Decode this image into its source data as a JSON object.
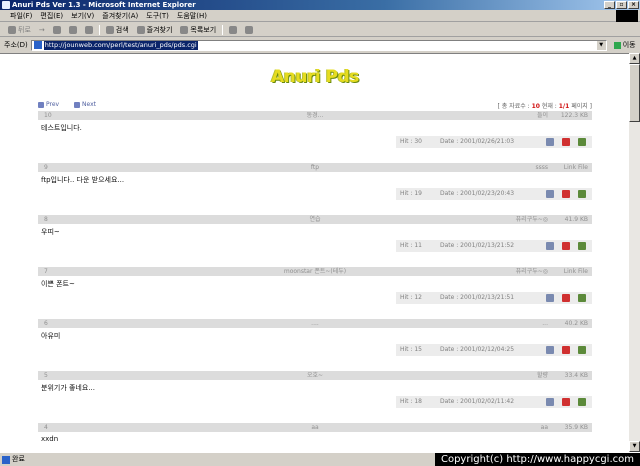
{
  "window": {
    "title": "Anuri Pds Ver 1.3 - Microsoft Internet Explorer",
    "btn_min": "_",
    "btn_max": "▫",
    "btn_close": "×"
  },
  "menu": [
    "파일(F)",
    "편집(E)",
    "보기(V)",
    "즐겨찾기(A)",
    "도구(T)",
    "도움말(H)"
  ],
  "toolbar": {
    "back": "뒤로",
    "forward": "→",
    "search": "검색",
    "favorites": "즐겨찾기",
    "history": "목록보기"
  },
  "address": {
    "label": "주소(D)",
    "url": "http://jounweb.com/perl/test/anuri_pds/pds.cgi",
    "go": "이동"
  },
  "logo": "Anuri Pds",
  "nav": {
    "prev": "Prev",
    "next": "Next",
    "info_prefix": "[ 총 자료수 : ",
    "total": "10",
    "info_mid": " 현재 : ",
    "page": "1/1",
    "info_suffix": " 페이지 ]"
  },
  "posts": [
    {
      "num": "10",
      "title": "동경...",
      "author": "들이",
      "size": "122.3 KB",
      "body": "테스트입니다.",
      "hit": "Hit : 30",
      "date": "Date : 2001/02/26/21:03"
    },
    {
      "num": "9",
      "title": "ftp",
      "author": "ssss",
      "size": "Link File",
      "body": "ftp입니다.. 다운 받으세요...",
      "hit": "Hit : 19",
      "date": "Date : 2001/02/23/20:43"
    },
    {
      "num": "8",
      "title": "연습",
      "author": "퓨리구두~◎",
      "size": "41.9 KB",
      "body": "우띠~",
      "hit": "Hit : 11",
      "date": "Date : 2001/02/13/21:52"
    },
    {
      "num": "7",
      "title": "moonstar 폰트~(테두)",
      "author": "퓨리구두~◎",
      "size": "Link File",
      "body": "이쁜 폰트~",
      "hit": "Hit : 12",
      "date": "Date : 2001/02/13/21:51"
    },
    {
      "num": "6",
      "title": "....",
      "author": "...",
      "size": "40.2 KB",
      "body": "아유미",
      "hit": "Hit : 15",
      "date": "Date : 2001/02/12/04:25"
    },
    {
      "num": "5",
      "title": "오호~",
      "author": "할량",
      "size": "33.4 KB",
      "body": "분위기가 좋네요...",
      "hit": "Hit : 18",
      "date": "Date : 2001/02/02/11:42"
    },
    {
      "num": "4",
      "title": "aa",
      "author": "aa",
      "size": "35.9 KB",
      "body": "xxdn",
      "hit": "",
      "date": ""
    }
  ],
  "status": {
    "text": "완료",
    "copyright": "Copyright(c) http://www.happycgi.com"
  }
}
